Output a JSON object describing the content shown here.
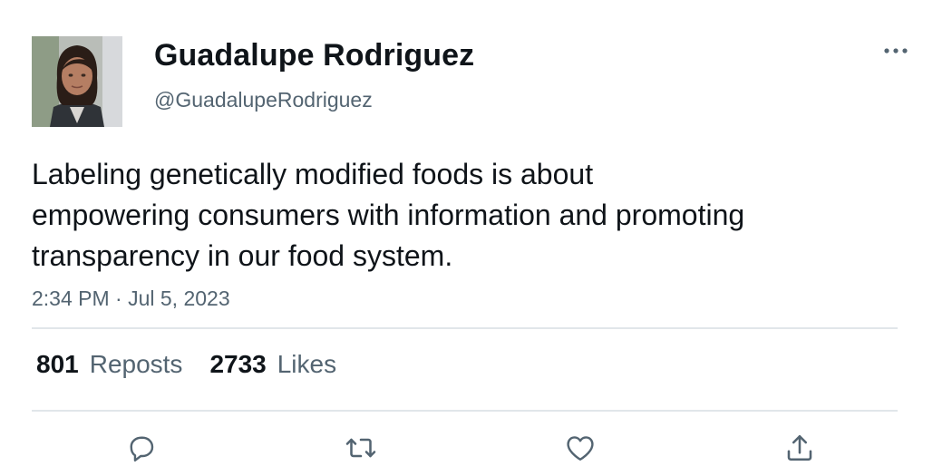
{
  "author": {
    "display_name": "Guadalupe Rodriguez",
    "handle": "@GuadalupeRodriguez"
  },
  "tweet": {
    "text_lines": [
      "Labeling genetically modified foods is about",
      "empowering consumers with information and promoting",
      "transparency in our food system."
    ],
    "timestamp": "2:34 PM · Jul 5, 2023"
  },
  "stats": {
    "reposts_count": "801",
    "reposts_label": "Reposts",
    "likes_count": "2733",
    "likes_label": "Likes"
  },
  "icons": {
    "more": "more-horizontal-icon",
    "reply": "reply-icon",
    "repost": "repost-icon",
    "like": "heart-icon",
    "share": "share-icon"
  },
  "colors": {
    "primary_text": "#0f1419",
    "secondary_text": "#536471",
    "divider": "#e1e6ea",
    "icon": "#536471"
  }
}
